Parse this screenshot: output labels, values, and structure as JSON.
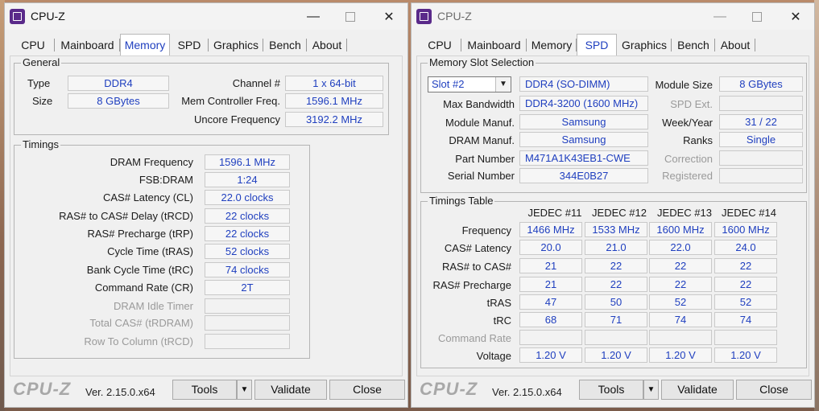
{
  "left": {
    "title": "CPU-Z",
    "tabs": [
      "CPU",
      "Mainboard",
      "Memory",
      "SPD",
      "Graphics",
      "Bench",
      "About"
    ],
    "active_tab": "Memory",
    "general": {
      "title": "General",
      "type_label": "Type",
      "type_value": "DDR4",
      "size_label": "Size",
      "size_value": "8 GBytes",
      "channel_label": "Channel #",
      "channel_value": "1 x 64-bit",
      "memctrl_label": "Mem Controller Freq.",
      "memctrl_value": "1596.1 MHz",
      "uncore_label": "Uncore Frequency",
      "uncore_value": "3192.2 MHz"
    },
    "timings": {
      "title": "Timings",
      "rows": [
        {
          "label": "DRAM Frequency",
          "value": "1596.1 MHz"
        },
        {
          "label": "FSB:DRAM",
          "value": "1:24"
        },
        {
          "label": "CAS# Latency (CL)",
          "value": "22.0 clocks"
        },
        {
          "label": "RAS# to CAS# Delay (tRCD)",
          "value": "22 clocks"
        },
        {
          "label": "RAS# Precharge (tRP)",
          "value": "22 clocks"
        },
        {
          "label": "Cycle Time (tRAS)",
          "value": "52 clocks"
        },
        {
          "label": "Bank Cycle Time (tRC)",
          "value": "74 clocks"
        },
        {
          "label": "Command Rate (CR)",
          "value": "2T"
        },
        {
          "label": "DRAM Idle Timer",
          "value": ""
        },
        {
          "label": "Total CAS# (tRDRAM)",
          "value": ""
        },
        {
          "label": "Row To Column (tRCD)",
          "value": ""
        }
      ]
    },
    "footer": {
      "brand": "CPU-Z",
      "version": "Ver. 2.15.0.x64",
      "tools": "Tools",
      "validate": "Validate",
      "close": "Close"
    }
  },
  "right": {
    "title": "CPU-Z",
    "tabs": [
      "CPU",
      "Mainboard",
      "Memory",
      "SPD",
      "Graphics",
      "Bench",
      "About"
    ],
    "active_tab": "SPD",
    "slot": {
      "title": "Memory Slot Selection",
      "selected": "Slot #2",
      "type": "DDR4 (SO-DIMM)",
      "module_size_label": "Module Size",
      "module_size": "8 GBytes",
      "max_bw_label": "Max Bandwidth",
      "max_bw": "DDR4-3200 (1600 MHz)",
      "spd_ext_label": "SPD Ext.",
      "spd_ext": "",
      "module_manuf_label": "Module Manuf.",
      "module_manuf": "Samsung",
      "week_year_label": "Week/Year",
      "week_year": "31 / 22",
      "dram_manuf_label": "DRAM Manuf.",
      "dram_manuf": "Samsung",
      "ranks_label": "Ranks",
      "ranks": "Single",
      "part_label": "Part Number",
      "part": "M471A1K43EB1-CWE",
      "correction_label": "Correction",
      "correction": "",
      "serial_label": "Serial Number",
      "serial": "344E0B27",
      "registered_label": "Registered",
      "registered": ""
    },
    "timings_table": {
      "title": "Timings Table",
      "columns": [
        "JEDEC #11",
        "JEDEC #12",
        "JEDEC #13",
        "JEDEC #14"
      ],
      "rows": [
        {
          "label": "Frequency",
          "values": [
            "1466 MHz",
            "1533 MHz",
            "1600 MHz",
            "1600 MHz"
          ],
          "dim": false
        },
        {
          "label": "CAS# Latency",
          "values": [
            "20.0",
            "21.0",
            "22.0",
            "24.0"
          ],
          "dim": false
        },
        {
          "label": "RAS# to CAS#",
          "values": [
            "21",
            "22",
            "22",
            "22"
          ],
          "dim": false
        },
        {
          "label": "RAS# Precharge",
          "values": [
            "21",
            "22",
            "22",
            "22"
          ],
          "dim": false
        },
        {
          "label": "tRAS",
          "values": [
            "47",
            "50",
            "52",
            "52"
          ],
          "dim": false
        },
        {
          "label": "tRC",
          "values": [
            "68",
            "71",
            "74",
            "74"
          ],
          "dim": false
        },
        {
          "label": "Command Rate",
          "values": [
            "",
            "",
            "",
            ""
          ],
          "dim": true
        },
        {
          "label": "Voltage",
          "values": [
            "1.20 V",
            "1.20 V",
            "1.20 V",
            "1.20 V"
          ],
          "dim": false
        }
      ]
    },
    "footer": {
      "brand": "CPU-Z",
      "version": "Ver. 2.15.0.x64",
      "tools": "Tools",
      "validate": "Validate",
      "close": "Close"
    }
  }
}
